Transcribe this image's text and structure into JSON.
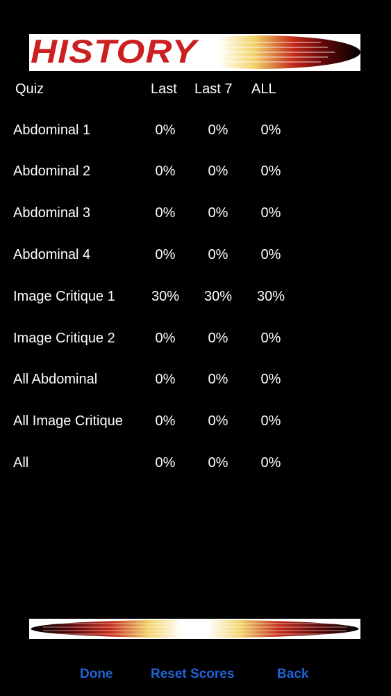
{
  "banner": {
    "title": "HISTORY"
  },
  "table": {
    "headers": {
      "quiz": "Quiz",
      "last": "Last",
      "last7": "Last 7",
      "all": "ALL"
    },
    "rows": [
      {
        "name": "Abdominal 1",
        "last": "0%",
        "last7": "0%",
        "all": "0%"
      },
      {
        "name": "Abdominal 2",
        "last": "0%",
        "last7": "0%",
        "all": "0%"
      },
      {
        "name": "Abdominal 3",
        "last": "0%",
        "last7": "0%",
        "all": "0%"
      },
      {
        "name": "Abdominal 4",
        "last": "0%",
        "last7": "0%",
        "all": "0%"
      },
      {
        "name": "Image Critique 1",
        "last": "30%",
        "last7": "30%",
        "all": "30%"
      },
      {
        "name": "Image Critique 2",
        "last": "0%",
        "last7": "0%",
        "all": "0%"
      },
      {
        "name": "All Abdominal",
        "last": "0%",
        "last7": "0%",
        "all": "0%"
      },
      {
        "name": "All Image Critique",
        "last": "0%",
        "last7": "0%",
        "all": "0%"
      },
      {
        "name": "All",
        "last": "0%",
        "last7": "0%",
        "all": "0%"
      }
    ]
  },
  "toolbar": {
    "done": "Done",
    "reset": "Reset Scores",
    "back": "Back"
  },
  "colors": {
    "background": "#000000",
    "text": "#ffffff",
    "title": "#cc1f1f",
    "button": "#1f63d8"
  }
}
